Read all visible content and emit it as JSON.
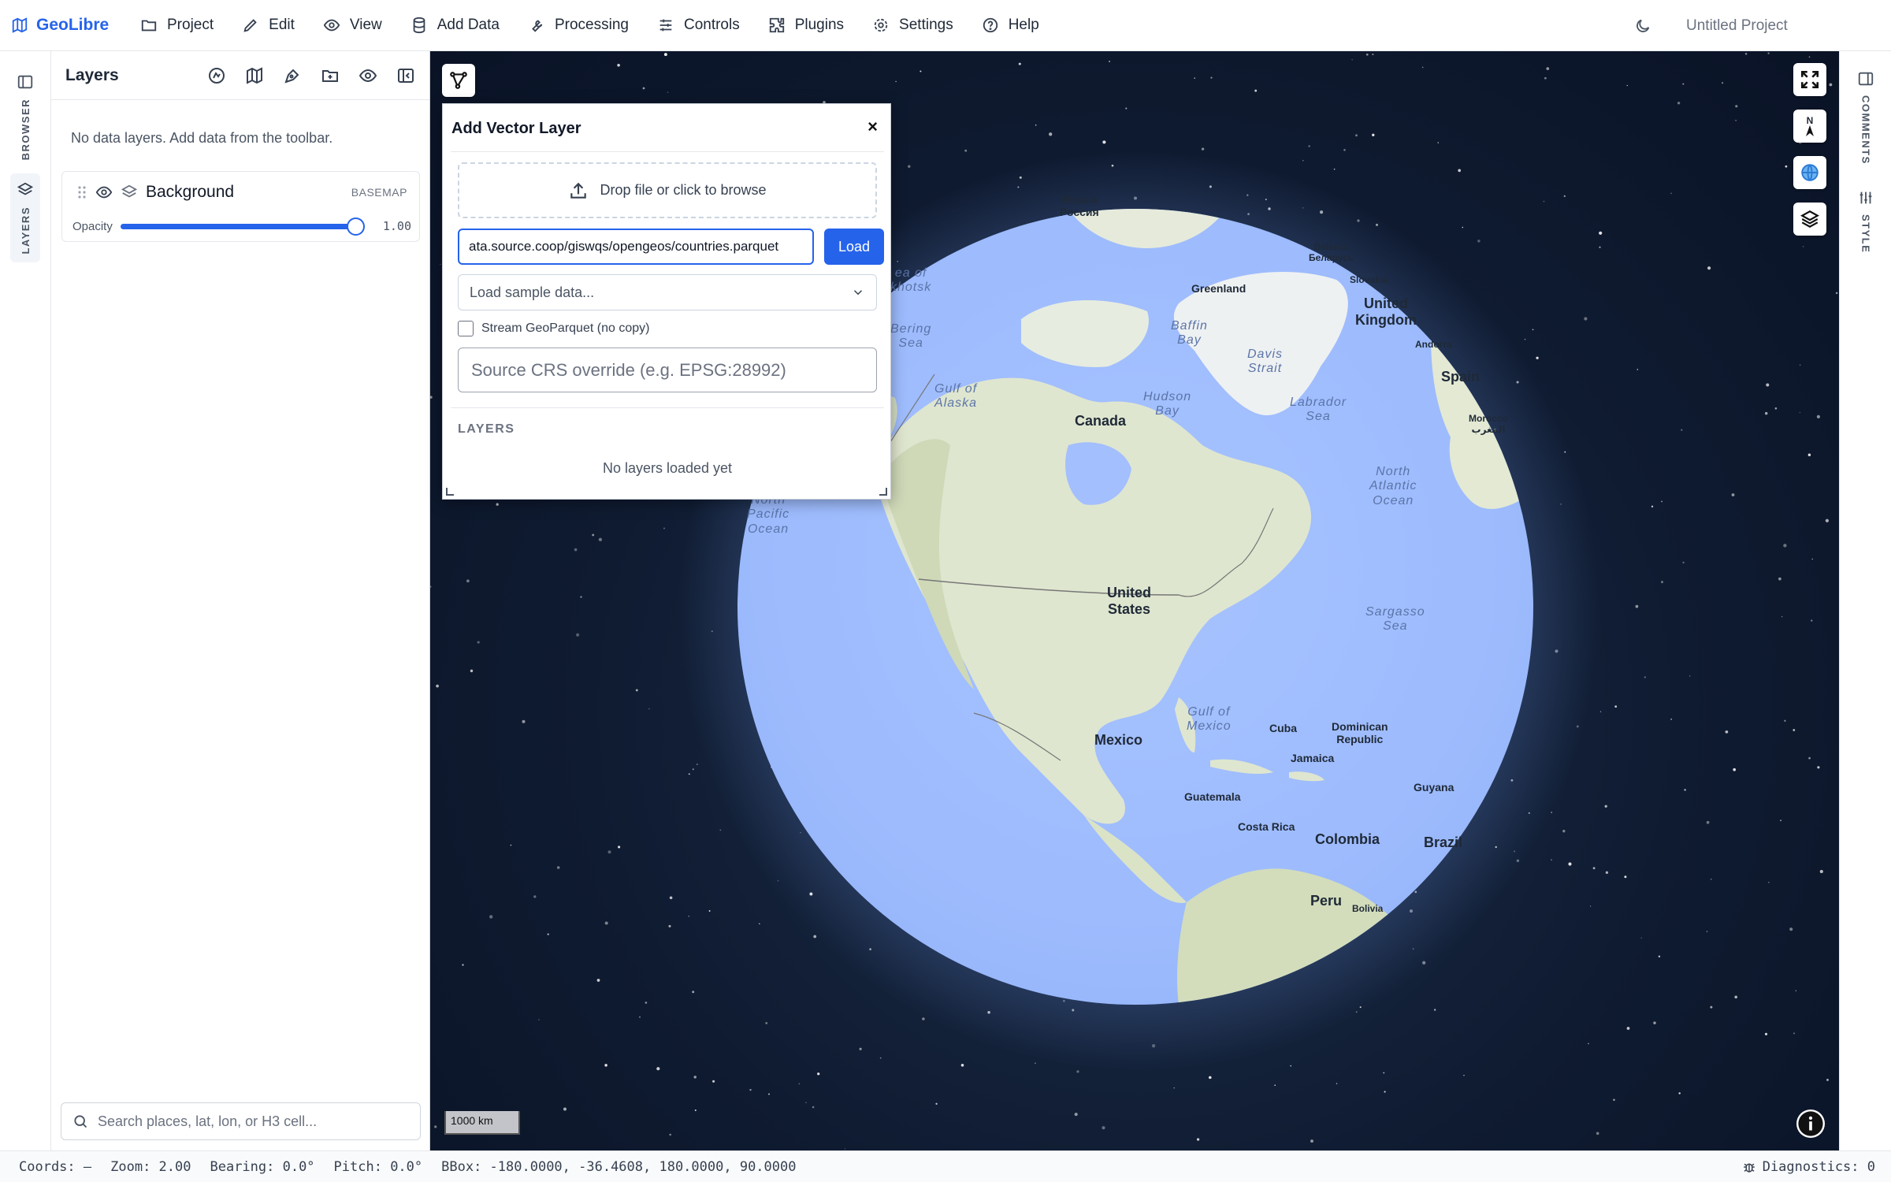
{
  "app": {
    "name": "GeoLibre",
    "project_title": "Untitled Project"
  },
  "menu": [
    {
      "label": "Project",
      "icon": "folder-icon"
    },
    {
      "label": "Edit",
      "icon": "pencil-icon"
    },
    {
      "label": "View",
      "icon": "eye-icon"
    },
    {
      "label": "Add Data",
      "icon": "database-icon"
    },
    {
      "label": "Processing",
      "icon": "wrench-icon"
    },
    {
      "label": "Controls",
      "icon": "sliders-icon"
    },
    {
      "label": "Plugins",
      "icon": "puzzle-icon"
    },
    {
      "label": "Settings",
      "icon": "gear-icon"
    },
    {
      "label": "Help",
      "icon": "help-circle-icon"
    }
  ],
  "left_rail": {
    "browser_label": "BROWSER",
    "layers_label": "LAYERS"
  },
  "right_rail": {
    "comments_label": "COMMENTS",
    "style_label": "STYLE"
  },
  "layers_panel": {
    "title": "Layers",
    "empty_message": "No data layers. Add data from the toolbar.",
    "layer": {
      "name": "Background",
      "badge": "BASEMAP",
      "opacity_label": "Opacity",
      "opacity_value": "1.00",
      "opacity_fraction": 1.0
    },
    "search_placeholder": "Search places, lat, lon, or H3 cell..."
  },
  "dialog": {
    "title": "Add Vector Layer",
    "close": "×",
    "dropzone_text": "Drop file or click to browse",
    "url_value": "ata.source.coop/giswqs/opengeos/countries.parquet",
    "load_label": "Load",
    "sample_placeholder": "Load sample data...",
    "stream_label": "Stream GeoParquet (no copy)",
    "crs_placeholder": "Source CRS override (e.g. EPSG:28992)",
    "layers_heading": "LAYERS",
    "no_layers": "No layers loaded yet"
  },
  "map": {
    "scale": "1000 km",
    "compass": "N",
    "labels": {
      "russia": "Russia\nРоссия",
      "belarus": "Belarus\nБеларусь",
      "slovakia": "Slovakia",
      "greenland": "Greenland",
      "uk": "United\nKingdom",
      "andorra": "Andorra",
      "spain": "Spain",
      "morocco": "Morocco\nالمغرب",
      "canada": "Canada",
      "us": "United\nStates",
      "mexico": "Mexico",
      "cuba": "Cuba",
      "dominican": "Dominican\nRepublic",
      "jamaica": "Jamaica",
      "guatemala": "Guatemala",
      "costa_rica": "Costa Rica",
      "colombia": "Colombia",
      "guyana": "Guyana",
      "brazil": "Brazil",
      "peru": "Peru",
      "bolivia": "Bolivia",
      "okhotsk": "ea of\nkhotsk",
      "bering": "Bering\nSea",
      "baffin": "Baffin\nBay",
      "davis": "Davis\nStrait",
      "hudson": "Hudson\nBay",
      "labrador": "Labrador\nSea",
      "alaska": "Gulf of\nAlaska",
      "north_atlantic": "North\nAtlantic\nOcean",
      "north_pacific": "North\nPacific\nOcean",
      "sargasso": "Sargasso\nSea",
      "gulf_mexico": "Gulf of\nMexico"
    }
  },
  "status": {
    "coords": "Coords: —",
    "zoom": "Zoom: 2.00",
    "bearing": "Bearing: 0.0°",
    "pitch": "Pitch: 0.0°",
    "bbox": "BBox: -180.0000, -36.4608, 180.0000, 90.0000",
    "diagnostics": "Diagnostics: 0"
  },
  "colors": {
    "accent": "#2563eb",
    "space": "#0f1b31",
    "ocean": "#9dbbfd",
    "land": "#dfe6cf"
  }
}
